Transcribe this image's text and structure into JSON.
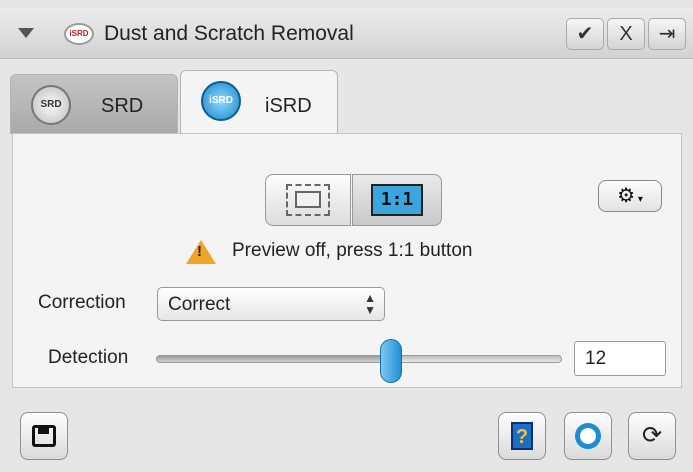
{
  "header": {
    "title": "Dust and Scratch Removal",
    "logo_text": "iSRD",
    "check_label": "✔",
    "close_label": "X",
    "exit_label": "⇥"
  },
  "tabs": [
    {
      "label": "SRD",
      "icon_text": "SRD",
      "active": false
    },
    {
      "label": "iSRD",
      "icon_text": "iSRD",
      "active": true
    }
  ],
  "preview": {
    "one_to_one_label": "1:1",
    "warning_text": "Preview off, press 1:1 button"
  },
  "settings": {
    "gear_label": "⚙"
  },
  "correction": {
    "label": "Correction",
    "value": "Correct"
  },
  "detection": {
    "label": "Detection",
    "value": "12",
    "slider_fraction": 0.58
  },
  "footer": {
    "help_label": "?",
    "reset_label": "⟳"
  },
  "colors": {
    "accent": "#1f90d4",
    "warning": "#f0a42a"
  }
}
